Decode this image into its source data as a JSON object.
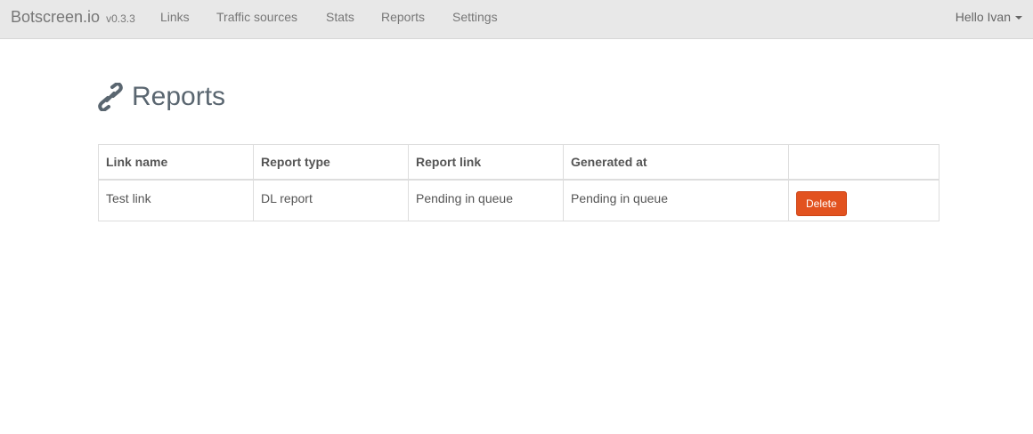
{
  "navbar": {
    "brand": "Botscreen.io",
    "version": "v0.3.3",
    "links": [
      "Links",
      "Traffic sources",
      "Stats",
      "Reports",
      "Settings"
    ],
    "user_greeting": "Hello Ivan"
  },
  "page": {
    "title": "Reports",
    "title_icon": "link-icon",
    "accent_color": "#e2521f"
  },
  "table": {
    "headers": [
      "Link name",
      "Report type",
      "Report link",
      "Generated at",
      ""
    ],
    "rows": [
      {
        "link_name": "Test link",
        "report_type": "DL report",
        "report_link": "Pending in queue",
        "generated_at": "Pending in queue",
        "action_label": "Delete"
      }
    ]
  }
}
